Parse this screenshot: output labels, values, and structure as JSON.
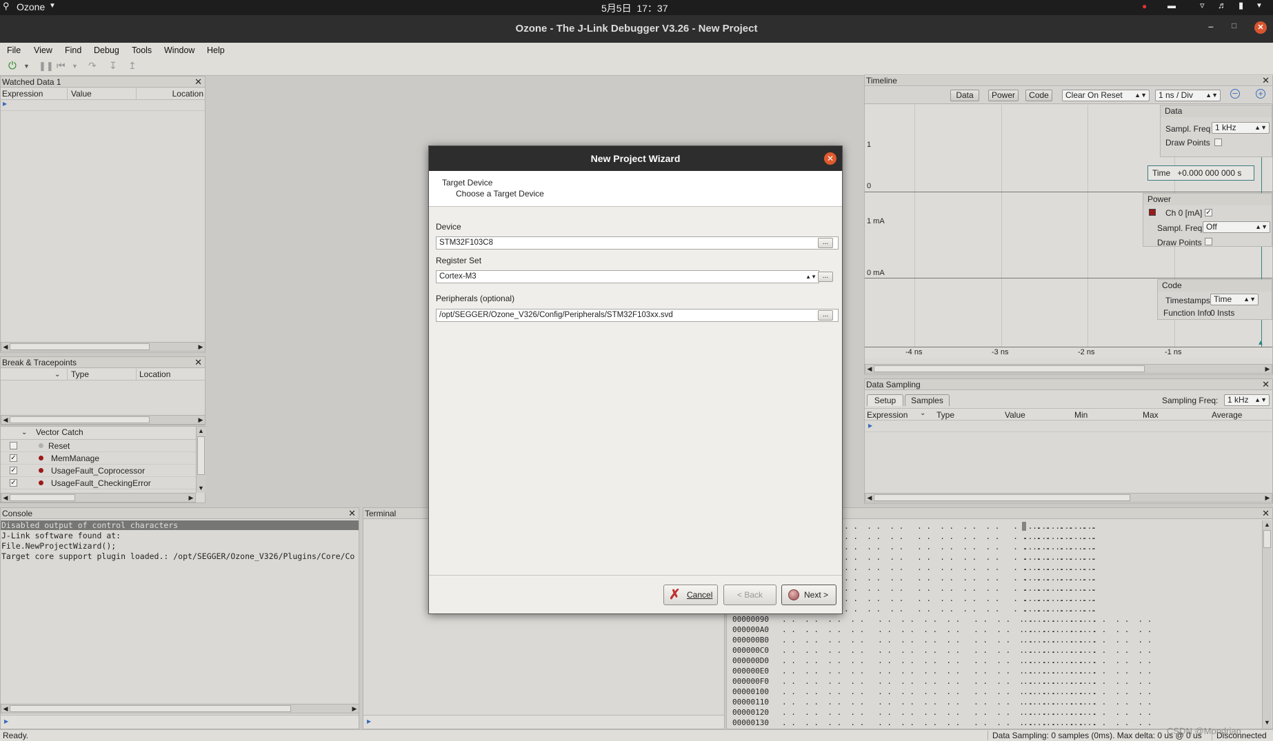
{
  "system": {
    "app_menu": "Ozone",
    "datetime": "5月5日  17：37"
  },
  "window": {
    "title": "Ozone - The J-Link Debugger V3.26 - New Project"
  },
  "menubar": {
    "items": [
      "File",
      "View",
      "Find",
      "Debug",
      "Tools",
      "Window",
      "Help"
    ]
  },
  "watched": {
    "title": "Watched Data 1",
    "cols": [
      "Expression",
      "Value",
      "Location"
    ]
  },
  "breakpoints": {
    "title": "Break & Tracepoints",
    "cols": [
      "Type",
      "Location"
    ]
  },
  "vector_catch": {
    "header": "Vector Catch",
    "items": [
      {
        "label": "Reset",
        "checked": false,
        "dot": "#b9b7b3"
      },
      {
        "label": "MemManage",
        "checked": true,
        "dot": "#a01818"
      },
      {
        "label": "UsageFault_Coprocessor",
        "checked": true,
        "dot": "#a01818"
      },
      {
        "label": "UsageFault_CheckingError",
        "checked": true,
        "dot": "#a01818"
      }
    ]
  },
  "console": {
    "title": "Console",
    "lines": [
      "Disabled output of control characters",
      "J-Link software found at:",
      "File.NewProjectWizard();",
      "Target core support plugin loaded.: /opt/SEGGER/Ozone_V326/Plugins/Core/Co"
    ]
  },
  "terminal": {
    "title": "Terminal"
  },
  "timeline": {
    "title": "Timeline",
    "buttons": [
      "Data",
      "Power",
      "Code"
    ],
    "clear_on_reset": "Clear On Reset",
    "zoom": "1 ns / Div",
    "y_labels": [
      "1",
      "0",
      "1 mA",
      "0 mA"
    ],
    "x_labels": [
      "-4 ns",
      "-3 ns",
      "-2 ns",
      "-1 ns"
    ],
    "data_box": {
      "title": "Data",
      "sampl_freq_label": "Sampl. Freq",
      "sampl_freq": "1 kHz",
      "draw_points_label": "Draw Points"
    },
    "time_label": "Time",
    "time_value": "+0.000 000 000 s",
    "power_box": {
      "title": "Power",
      "channel": "Ch 0 [mA]",
      "sampl_freq_label": "Sampl. Freq",
      "sampl_freq": "Off",
      "draw_points_label": "Draw Points"
    },
    "code_box": {
      "title": "Code",
      "timestamps_label": "Timestamps",
      "timestamps": "Time",
      "function_info_label": "Function Info",
      "function_info": "0 Insts"
    }
  },
  "data_sampling": {
    "title": "Data Sampling",
    "tabs": [
      "Setup",
      "Samples"
    ],
    "freq_label": "Sampling Freq:",
    "freq": "1 kHz",
    "cols": [
      "Expression",
      "Type",
      "Value",
      "Min",
      "Max",
      "Average"
    ]
  },
  "memory": {
    "dots": ". .  . .  . .  . .   . .  . .  . .  . .   . .  . .  . .  . .   . .  . .  . .  . .",
    "ascii": "................",
    "rows_hidden": 9,
    "addresses": [
      "00000090",
      "000000A0",
      "000000B0",
      "000000C0",
      "000000D0",
      "000000E0",
      "000000F0",
      "00000100",
      "00000110",
      "00000120",
      "00000130"
    ]
  },
  "status": {
    "left": "Ready.",
    "sampling": "Data Sampling: 0 samples (0ms). Max delta: 0 us @ 0 us",
    "conn": "Disconnected",
    "watermark": "CSDN @Mondrian"
  },
  "dialog": {
    "title": "New Project Wizard",
    "step_title": "Target Device",
    "step_sub": "Choose a Target Device",
    "device_label": "Device",
    "device": "STM32F103C8",
    "register_label": "Register Set",
    "register": "Cortex-M3",
    "periph_label": "Peripherals (optional)",
    "periph": "/opt/SEGGER/Ozone_V326/Config/Peripherals/STM32F103xx.svd",
    "dots": "...",
    "cancel": "Cancel",
    "back": "< Back",
    "next": "Next >"
  }
}
